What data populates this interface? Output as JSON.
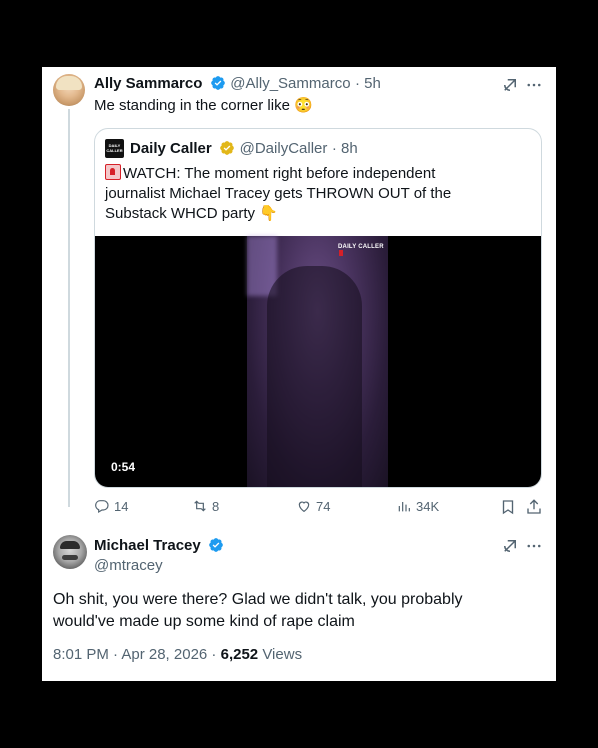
{
  "colors": {
    "verified_blue": "#1d9bf0",
    "verified_gold": "#e2b719",
    "muted": "#536471",
    "alert_red": "#d62028"
  },
  "parent_tweet": {
    "author_name": "Ally Sammarco",
    "handle": "@Ally_Sammarco",
    "time": "· 5h",
    "text": "Me standing in the corner like 😳",
    "quoted": {
      "author_name": "Daily Caller",
      "handle": "@DailyCaller",
      "time": "· 8h",
      "text_line1": "WATCH: The moment right before independent",
      "text_line2": "journalist Michael Tracey gets THROWN OUT of the",
      "text_line3": "Substack WHCD party 👇",
      "avatar_text": "DAILY CALLER",
      "video_watermark": "DAILY CALLER",
      "video_duration": "0:54"
    },
    "actions": {
      "replies": "14",
      "reposts": "8",
      "likes": "74",
      "views": "34K"
    },
    "icons": [
      "grok-icon",
      "more-icon",
      "reply-icon",
      "repost-icon",
      "like-icon",
      "views-icon",
      "bookmark-icon",
      "share-icon"
    ]
  },
  "reply_tweet": {
    "author_name": "Michael Tracey",
    "handle": "@mtracey",
    "text_line1": "Oh shit, you were there? Glad we didn't talk, you probably",
    "text_line2": "would've made up some kind of rape claim",
    "timestamp": "8:01 PM · Apr 28, 2026 ·",
    "views_count": "6,252",
    "views_label": "Views"
  }
}
